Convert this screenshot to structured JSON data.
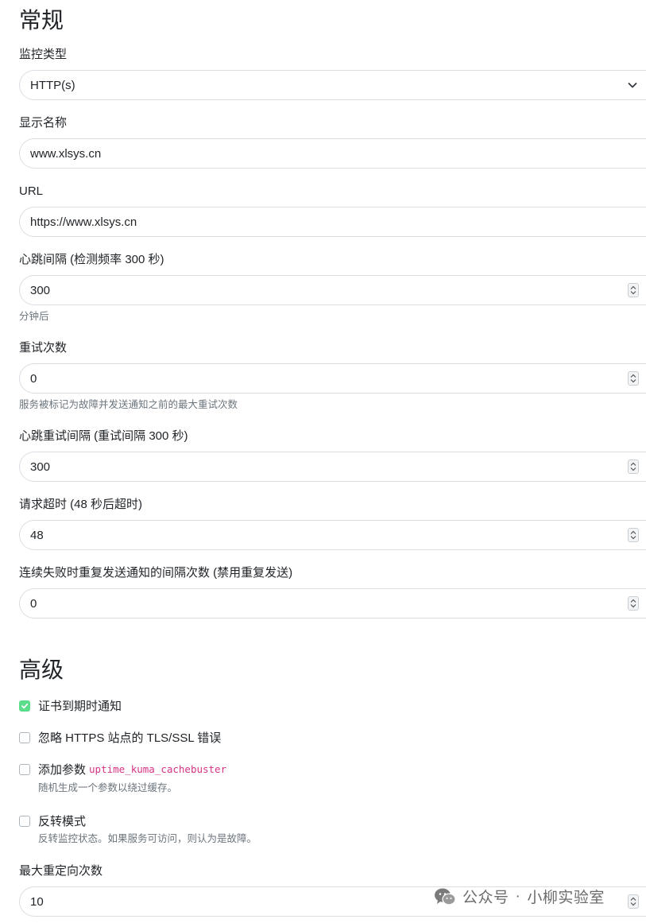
{
  "general": {
    "title": "常规",
    "monitor_type": {
      "label": "监控类型",
      "value": "HTTP(s)"
    },
    "display_name": {
      "label": "显示名称",
      "value": "www.xlsys.cn"
    },
    "url": {
      "label": "URL",
      "value": "https://www.xlsys.cn"
    },
    "heartbeat_interval": {
      "label": "心跳间隔 (检测频率 300 秒)",
      "value": "300",
      "help": "分钟后"
    },
    "retries": {
      "label": "重试次数",
      "value": "0",
      "help": "服务被标记为故障并发送通知之前的最大重试次数"
    },
    "retry_interval": {
      "label": "心跳重试间隔 (重试间隔 300 秒)",
      "value": "300"
    },
    "request_timeout": {
      "label": "请求超时 (48 秒后超时)",
      "value": "48"
    },
    "resend_interval": {
      "label": "连续失败时重复发送通知的间隔次数 (禁用重复发送)",
      "value": "0"
    }
  },
  "advanced": {
    "title": "高级",
    "cert_expiry": {
      "label": "证书到期时通知",
      "checked": true
    },
    "ignore_tls": {
      "label": "忽略 HTTPS 站点的 TLS/SSL 错误",
      "checked": false
    },
    "cache_buster": {
      "label": "添加参数",
      "param": "uptime_kuma_cachebuster",
      "help": "随机生成一个参数以绕过缓存。",
      "checked": false
    },
    "upside_down": {
      "label": "反转模式",
      "help": "反转监控状态。如果服务可访问，则认为是故障。",
      "checked": false
    },
    "max_redirects": {
      "label": "最大重定向次数",
      "value": "10"
    }
  },
  "watermark": {
    "text_left": "公众号",
    "separator": "·",
    "text_right": "小柳实验室"
  },
  "colors": {
    "accent": "#5cdd8b",
    "code": "#d63384",
    "muted": "#6c757d",
    "border": "#d9dee3"
  }
}
